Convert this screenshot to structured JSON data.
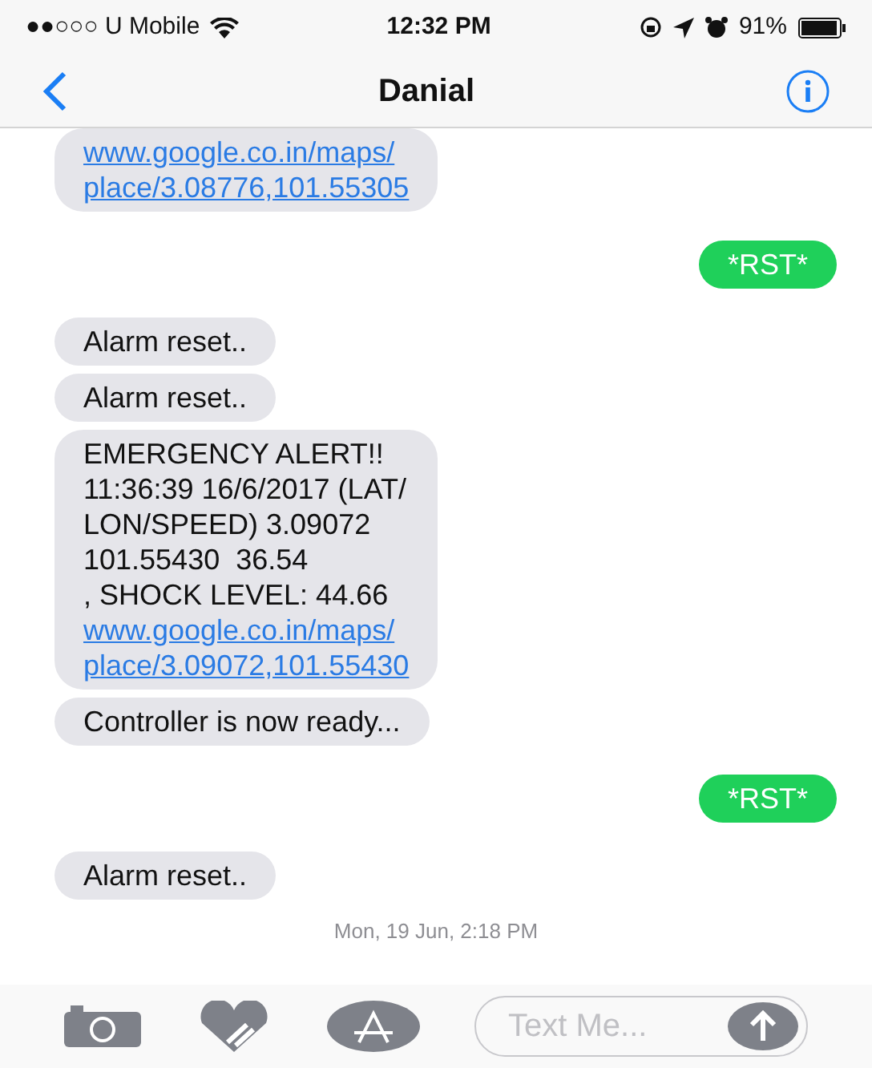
{
  "status_bar": {
    "carrier": "●●○○○ U Mobile",
    "time": "12:32 PM",
    "battery": "91%"
  },
  "nav": {
    "title": "Danial"
  },
  "messages": [
    {
      "kind": "incoming",
      "parts": [
        {
          "kind": "link",
          "lines": [
            "www.google.co.in/maps/",
            "place/3.08776,101.55305"
          ]
        }
      ]
    },
    {
      "kind": "outgoing",
      "parts": [
        {
          "kind": "text",
          "lines": [
            "*RST*"
          ]
        }
      ]
    },
    {
      "kind": "incoming",
      "parts": [
        {
          "kind": "text",
          "lines": [
            "Alarm reset.."
          ]
        }
      ]
    },
    {
      "kind": "incoming",
      "parts": [
        {
          "kind": "text",
          "lines": [
            "Alarm reset.."
          ]
        }
      ]
    },
    {
      "kind": "incoming",
      "parts": [
        {
          "kind": "text",
          "lines": [
            "EMERGENCY ALERT!!",
            "11:36:39 16/6/2017 (LAT/",
            "LON/SPEED) 3.09072",
            "101.55430  36.54",
            ", SHOCK LEVEL: 44.66"
          ]
        },
        {
          "kind": "link",
          "lines": [
            "www.google.co.in/maps/",
            "place/3.09072,101.55430"
          ]
        }
      ]
    },
    {
      "kind": "incoming",
      "parts": [
        {
          "kind": "text",
          "lines": [
            "Controller is now ready..."
          ]
        }
      ]
    },
    {
      "kind": "outgoing",
      "parts": [
        {
          "kind": "text",
          "lines": [
            "*RST*"
          ]
        }
      ]
    },
    {
      "kind": "incoming",
      "parts": [
        {
          "kind": "text",
          "lines": [
            "Alarm reset.."
          ]
        }
      ]
    }
  ],
  "timestamp": "Mon, 19 Jun, 2:18 PM",
  "composer": {
    "placeholder": "Text Me..."
  }
}
